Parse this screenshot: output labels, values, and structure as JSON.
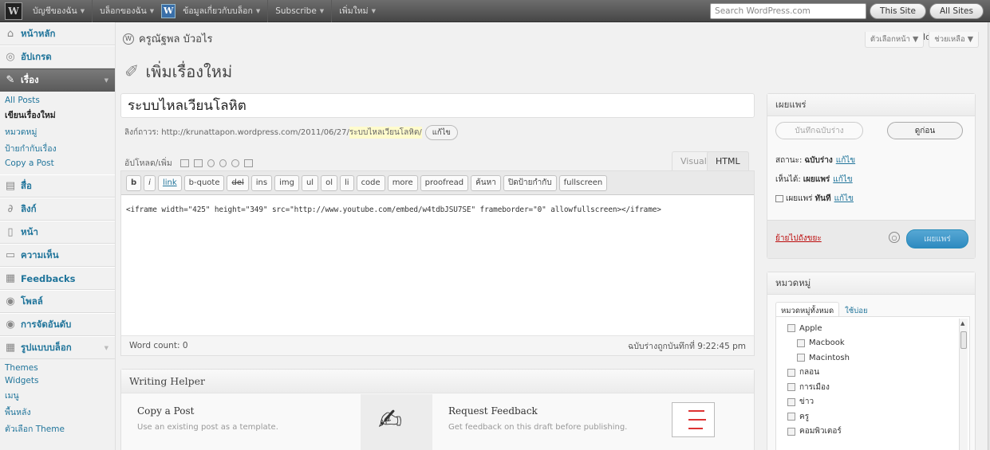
{
  "adminbar": {
    "items": [
      {
        "label": "บัญชีของฉัน",
        "has_caret": true
      },
      {
        "label": "บล็อกของฉัน",
        "has_caret": true
      },
      {
        "label": "ข้อมูลเกี่ยวกับบล็อก",
        "has_caret": true,
        "icon": "W"
      },
      {
        "label": "Subscribe",
        "has_caret": true
      },
      {
        "label": "เพิ่มใหม่",
        "has_caret": true
      }
    ],
    "search_placeholder": "Search WordPress.com",
    "this_site": "This Site",
    "all_sites": "All Sites"
  },
  "sidebar": {
    "dashboard": "หน้าหลัก",
    "upgrades": "อัปเกรด",
    "posts": "เรื่อง",
    "posts_sub": [
      "All Posts",
      "เขียนเรื่องใหม่",
      "หมวดหมู่",
      "ป้ายกำกับเรื่อง",
      "Copy a Post"
    ],
    "media": "สื่อ",
    "links": "ลิงก์",
    "pages": "หน้า",
    "comments": "ความเห็น",
    "feedbacks": "Feedbacks",
    "polls": "โพลล์",
    "ratings": "การจัดอันดับ",
    "appearance": "รูปแบบบล็อก",
    "appearance_sub": [
      "Themes",
      "Widgets",
      "เมนู",
      "พื้นหลัง",
      "ตัวเลือก Theme"
    ]
  },
  "header": {
    "site_name": "ครูณัฐพล บัวอไร",
    "howdy": "Howdy, NB",
    "screen_options": "ตัวเลือกหน้า",
    "help": "ช่วยเหลือ",
    "page_title": "เพิ่มเรื่องใหม่"
  },
  "editor": {
    "title": "ระบบไหลเวียนโลหิต",
    "permalink_label": "ลิงก์ถาวร:",
    "permalink_url": "http://krunattapon.wordpress.com/2011/06/27/",
    "permalink_slug": "ระบบไหลเวียนโลหิต/",
    "edit": "แก้ไข",
    "upload_label": "อัปโหลด/เพิ่ม",
    "tab_visual": "Visual",
    "tab_html": "HTML",
    "quicktags": [
      "b",
      "i",
      "link",
      "b-quote",
      "del",
      "ins",
      "img",
      "ul",
      "ol",
      "li",
      "code",
      "more",
      "proofread",
      "ค้นหา",
      "ปิดป้ายกำกับ",
      "fullscreen"
    ],
    "content": "<iframe width=\"425\" height=\"349\" src=\"http://www.youtube.com/embed/w4tdbJSU7SE\" frameborder=\"0\" allowfullscreen></iframe>",
    "word_count": "Word count: 0",
    "draft_saved": "ฉบับร่างถูกบันทึกที่ 9:22:45 pm"
  },
  "helper": {
    "heading": "Writing Helper",
    "copy_title": "Copy a Post",
    "copy_desc": "Use an existing post as a template.",
    "feedback_title": "Request Feedback",
    "feedback_desc": "Get feedback on this draft before publishing."
  },
  "publish": {
    "heading": "เผยแพร่",
    "save_draft": "บันทึกฉบับร่าง",
    "preview": "ดูก่อน",
    "status_label": "สถานะ:",
    "status_value": "ฉบับร่าง",
    "visibility_label": "เห็นได้:",
    "visibility_value": "เผยแพร่",
    "schedule_label": "เผยแพร่",
    "schedule_value": "ทันที",
    "edit": "แก้ไข",
    "trash": "ย้ายไปถังขยะ",
    "publish_btn": "เผยแพร่"
  },
  "categories": {
    "heading": "หมวดหมู่",
    "tab_all": "หมวดหมู่ทั้งหมด",
    "tab_popular": "ใช้บ่อย",
    "items": [
      {
        "name": "Apple",
        "level": 0
      },
      {
        "name": "Macbook",
        "level": 1
      },
      {
        "name": "Macintosh",
        "level": 1
      },
      {
        "name": "กลอน",
        "level": 0
      },
      {
        "name": "การเมือง",
        "level": 0
      },
      {
        "name": "ข่าว",
        "level": 0
      },
      {
        "name": "ครู",
        "level": 0
      },
      {
        "name": "คอมพิวเตอร์",
        "level": 0
      }
    ]
  },
  "colors": {
    "accent": "#21759b",
    "publish": "#2e8ac0",
    "trash": "#bc0b0b"
  }
}
